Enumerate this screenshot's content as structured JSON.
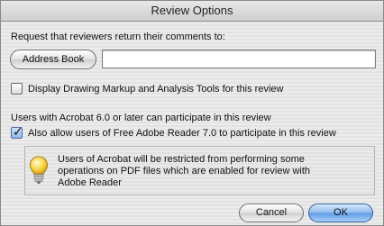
{
  "window": {
    "title": "Review Options"
  },
  "request_label": "Request that reviewers return their comments to:",
  "address_book_label": "Address Book",
  "return_address_value": "",
  "display_markup_label": "Display Drawing Markup and Analysis Tools for this review",
  "display_markup_checked": false,
  "acrobat_users_label": "Users with Acrobat 6.0 or later can participate in this review",
  "allow_reader_label": "Also allow users of Free Adobe Reader 7.0 to participate in this review",
  "allow_reader_checked": true,
  "info": {
    "icon": "lightbulb-icon",
    "line1": "Users of Acrobat will be restricted from performing some",
    "line2": "operations on PDF files which are enabled for review with",
    "line3": "Adobe Reader"
  },
  "buttons": {
    "cancel": "Cancel",
    "ok": "OK"
  }
}
